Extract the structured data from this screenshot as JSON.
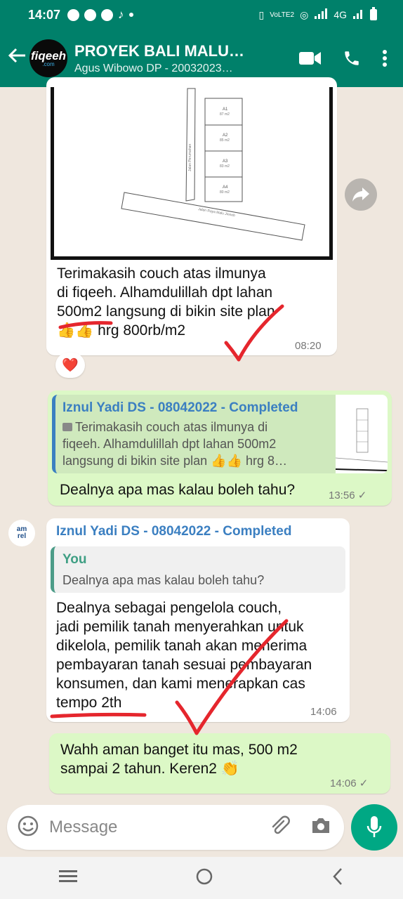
{
  "status_bar": {
    "time": "14:07",
    "network_labels": [
      "VoLTE2",
      "4G"
    ]
  },
  "header": {
    "avatar_logo": "fiqeeh",
    "avatar_logo_sub": ".com",
    "title": "PROYEK BALI MALU…",
    "subtitle": "Agus Wibowo DP - 20032023…"
  },
  "messages": {
    "m1": {
      "lines": [
        "Terimakasih couch atas ilmunya",
        "di fiqeeh.  Alhamdulillah dpt lahan",
        "500m2 langsung di bikin site plan",
        "hrg 800rb/m2"
      ],
      "emoji": "👍👍",
      "time": "08:20",
      "reaction": "❤️",
      "siteplan": {
        "plots": [
          "A1",
          "A2",
          "A3",
          "A4"
        ],
        "plot_areas": [
          "87 m2",
          "85 m2",
          "83 m2",
          "80 m2"
        ],
        "road_vertical": "Jalan Perumahan",
        "road_horizontal": "Jalan Raya Malu Jinneb"
      }
    },
    "m2": {
      "quote_name": "Iznul Yadi DS - 08042022 - Completed",
      "quote_lines": [
        "Terimakasih couch atas ilmunya di",
        "fiqeeh.  Alhamdulillah dpt lahan 500m2",
        "langsung di bikin site plan 👍👍 hrg 8…"
      ],
      "text": "Dealnya apa mas kalau boleh tahu?",
      "time": "13:56 ✓"
    },
    "m3": {
      "sender": "Iznul Yadi DS - 08042022 - Completed",
      "quote_name": "You",
      "quote_text": "Dealnya apa mas kalau boleh tahu?",
      "lines": [
        "Dealnya sebagai pengelola couch,",
        "jadi pemilik tanah menyerahkan untuk",
        "dikelola, pemilik tanah akan menerima",
        "pembayaran tanah sesuai pembayaran",
        "konsumen, dan kami menerapkan cas",
        "tempo 2th"
      ],
      "time": "14:06",
      "avatar_text": "am rel"
    },
    "m4": {
      "lines": [
        "Wahh aman banget itu mas, 500 m2",
        "sampai 2 tahun. Keren2"
      ],
      "emoji": "👏",
      "time": "14:06 ✓"
    }
  },
  "composer": {
    "placeholder": "Message"
  },
  "colors": {
    "header": "#00806a",
    "accent": "#00a884",
    "outgoing": "#dcf8c6",
    "annotation": "#e5262d",
    "quote_name_blue": "#3b7fc1"
  }
}
